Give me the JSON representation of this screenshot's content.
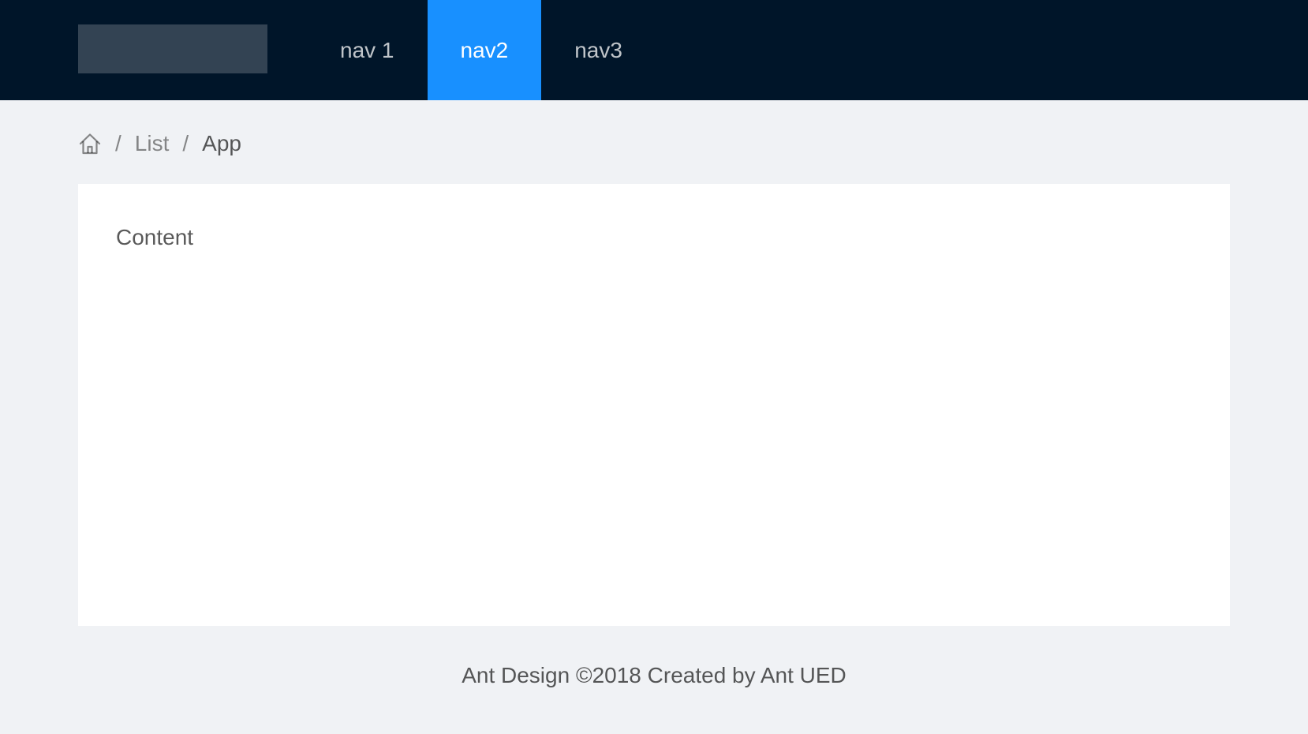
{
  "header": {
    "nav_items": [
      {
        "label": "nav 1",
        "selected": false
      },
      {
        "label": "nav2",
        "selected": true
      },
      {
        "label": "nav3",
        "selected": false
      }
    ]
  },
  "breadcrumb": {
    "home_icon": "home-icon",
    "separator": "/",
    "items": [
      "List",
      "App"
    ]
  },
  "content": {
    "text": "Content"
  },
  "footer": {
    "text": "Ant Design ©2018 Created by Ant UED"
  },
  "colors": {
    "header_bg": "#001529",
    "selected_nav_bg": "#1890ff",
    "page_bg": "#f0f2f5",
    "content_bg": "#ffffff"
  }
}
